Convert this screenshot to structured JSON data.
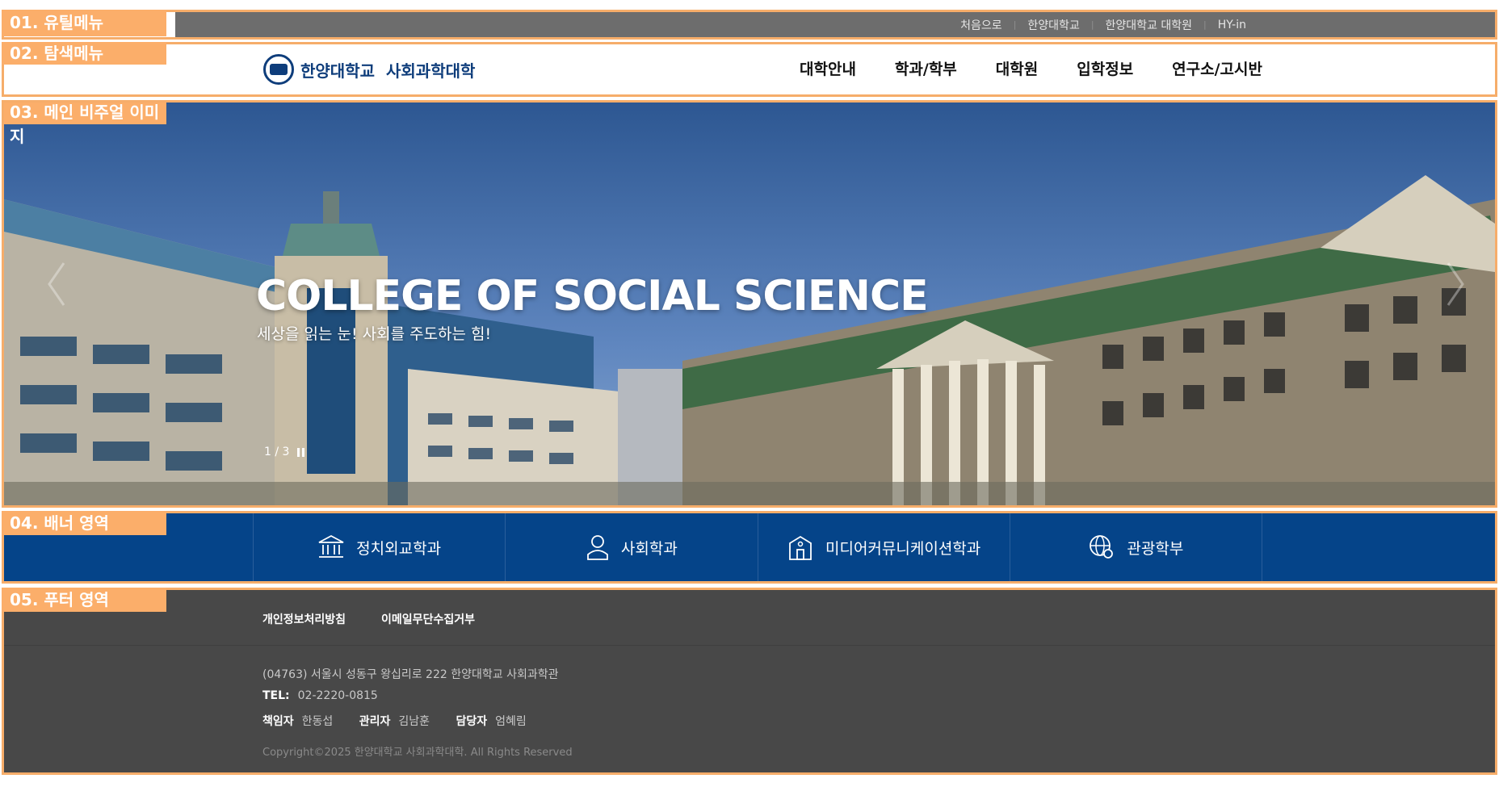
{
  "sections": {
    "s1": "01. 유틸메뉴",
    "s2": "02. 탐색메뉴",
    "s3": "03. 메인 비주얼 이미지",
    "s4": "04. 배너 영역",
    "s5": "05. 푸터 영역"
  },
  "util": [
    "처음으로",
    "한양대학교",
    "한양대학교 대학원",
    "HY-in"
  ],
  "logo": {
    "university": "한양대학교",
    "college": "사회과학대학"
  },
  "nav": [
    "대학안내",
    "학과/학부",
    "대학원",
    "입학정보",
    "연구소/고시반"
  ],
  "visual": {
    "title": "COLLEGE OF SOCIAL SCIENCE",
    "subtitle": "세상을 읽는 눈! 사회를 주도하는 힘!",
    "pager": "1 / 3"
  },
  "banners": [
    {
      "label": "정치외교학과",
      "icon": "building-columns-icon"
    },
    {
      "label": "사회학과",
      "icon": "person-icon"
    },
    {
      "label": "미디어커뮤니케이션학과",
      "icon": "media-building-icon"
    },
    {
      "label": "관광학부",
      "icon": "globe-pin-icon"
    }
  ],
  "footer": {
    "links": [
      "개인정보처리방침",
      "이메일무단수집거부"
    ],
    "address": "(04763) 서울시 성동구 왕십리로 222 한양대학교 사회과학관",
    "tel_label": "TEL:",
    "tel": "02-2220-0815",
    "staff": [
      {
        "role": "책임자",
        "name": "한동섭"
      },
      {
        "role": "관리자",
        "name": "김남훈"
      },
      {
        "role": "담당자",
        "name": "엄혜림"
      }
    ],
    "copyright": "Copyright©2025 한양대학교 사회과학대학. All Rights Reserved"
  },
  "colors": {
    "annotation": "#fbae6a",
    "banner": "#054489",
    "footer": "#484848",
    "utility": "#6d6d6d",
    "brand": "#0e3d7b"
  }
}
